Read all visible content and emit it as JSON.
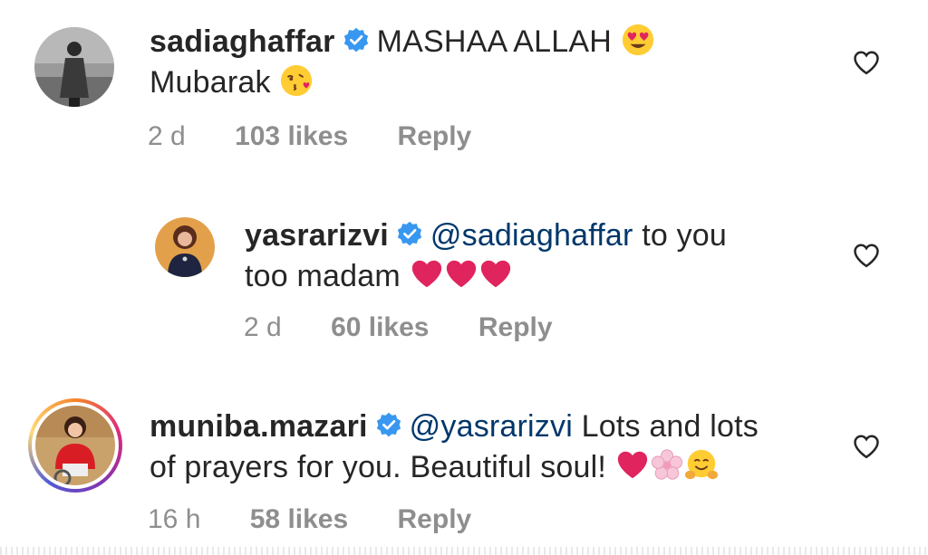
{
  "comments": [
    {
      "username": "sadiaghaffar",
      "verified": true,
      "text_line1": "MASHAA ALLAH",
      "text_line2": "Mubarak",
      "emoji1": "heart-eyes",
      "emoji2": "kissing-face",
      "time": "2 d",
      "likes": "103 likes",
      "reply": "Reply"
    },
    {
      "username": "yasrarizvi",
      "verified": true,
      "mention": "@sadiaghaffar",
      "text_line1": " to you",
      "text_line2": "too madam",
      "emojis": [
        "red-heart",
        "red-heart",
        "red-heart"
      ],
      "time": "2 d",
      "likes": "60 likes",
      "reply": "Reply"
    },
    {
      "username": "muniba.mazari",
      "verified": true,
      "mention": "@yasrarizvi",
      "text_line1": " Lots and lots",
      "text_line2": "of prayers for you. Beautiful soul!",
      "emojis": [
        "red-heart",
        "cherry-blossom",
        "hugging-face"
      ],
      "time": "16 h",
      "likes": "58 likes",
      "reply": "Reply"
    }
  ],
  "colors": {
    "text": "#262626",
    "meta": "#8e8e8e",
    "mention": "#00376b",
    "verified": "#3897f0",
    "heart": "#ed4956"
  }
}
